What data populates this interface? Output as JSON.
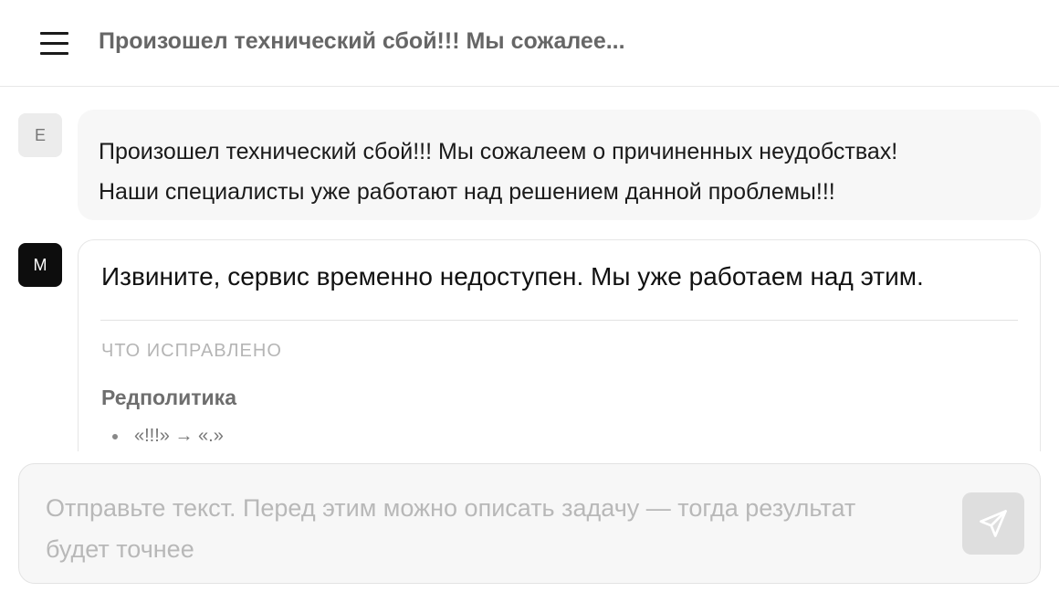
{
  "header": {
    "menu_icon": "hamburger-menu-icon",
    "title": "Произошел технический сбой!!! Мы сожалее..."
  },
  "messages": [
    {
      "role": "user",
      "avatar_letter": "E",
      "lines": [
        "Произошел технический сбой!!! Мы сожалеем о причиненных неудобствах!",
        "Наши специалисты уже работают над решением данной проблемы!!!"
      ]
    },
    {
      "role": "assistant",
      "avatar_letter": "M",
      "text": "Извините, сервис временно недоступен. Мы уже работаем над этим.",
      "fixed_heading": "ЧТО ИСПРАВЛЕНО",
      "section_title": "Редполитика",
      "fixes": [
        "«!!!» → «.»"
      ]
    }
  ],
  "composer": {
    "placeholder": "Отправьте текст. Перед этим можно описать задачу — тогда результат будет точнее",
    "value": "",
    "send_icon": "send-paper-plane-icon"
  },
  "colors": {
    "background": "#ffffff",
    "user_bubble": "#f7f7f7",
    "assistant_avatar": "#0d0d0d",
    "user_avatar": "#ececec",
    "send_button": "#dedede"
  }
}
